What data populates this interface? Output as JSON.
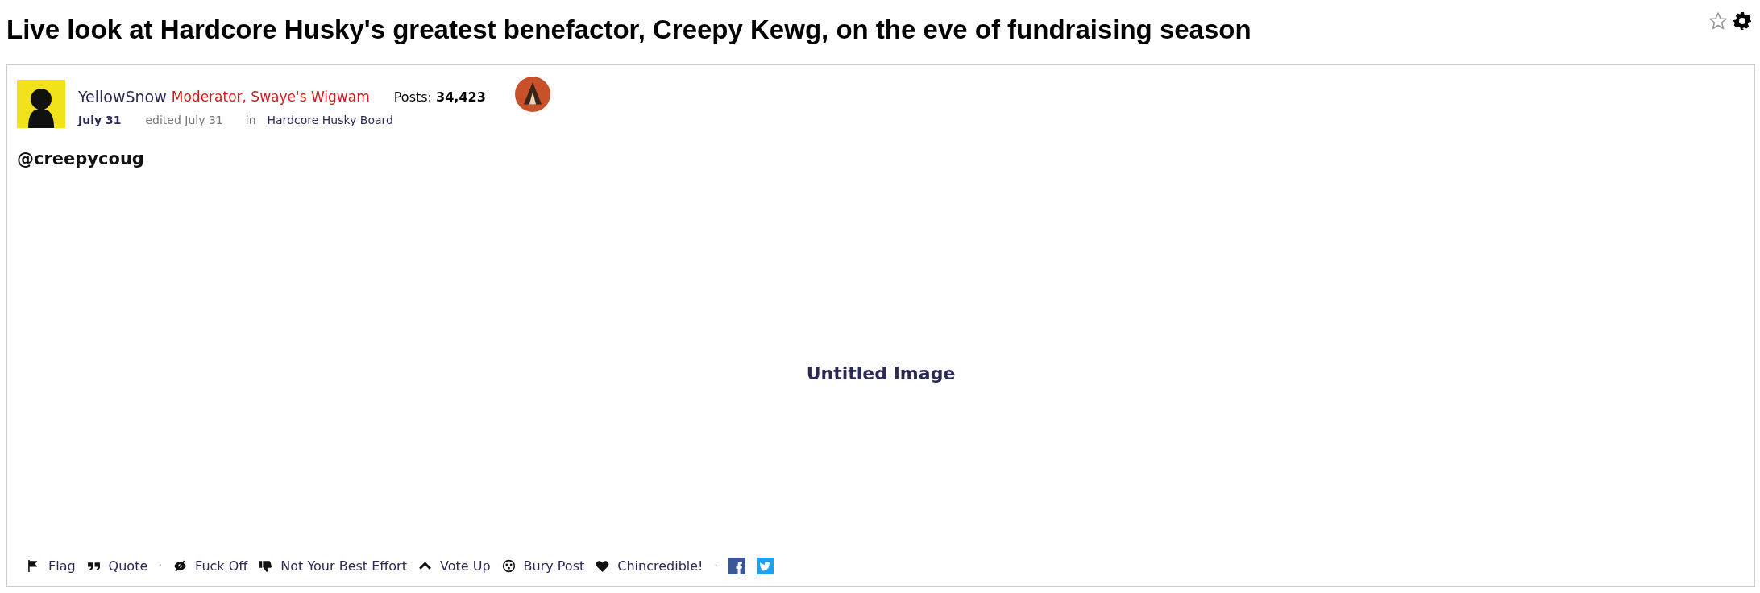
{
  "title": "Live look at Hardcore Husky's greatest benefactor, Creepy Kewg, on the eve of fundraising season",
  "bookmarked": false,
  "post": {
    "author": "YellowSnow",
    "role": "Moderator, Swaye's Wigwam",
    "posts_label": "Posts:",
    "posts_count": "34,423",
    "date": "July 31",
    "edited": "edited July 31",
    "in_label": "in",
    "category": "Hardcore Husky Board",
    "body": "@creepycoug",
    "image_alt": "Untitled Image"
  },
  "actions": [
    {
      "kind": "flag",
      "label": "Flag"
    },
    {
      "kind": "quote",
      "label": "Quote"
    },
    {
      "kind": "separator",
      "label": "·"
    },
    {
      "kind": "eye-off",
      "label": "Fuck Off"
    },
    {
      "kind": "thumbs-down",
      "label": "Not Your Best Effort"
    },
    {
      "kind": "vote-up",
      "label": "Vote Up"
    },
    {
      "kind": "bury",
      "label": "Bury Post"
    },
    {
      "kind": "heart",
      "label": "Chincredible!"
    },
    {
      "kind": "separator",
      "label": "·"
    },
    {
      "kind": "facebook"
    },
    {
      "kind": "twitter"
    }
  ]
}
